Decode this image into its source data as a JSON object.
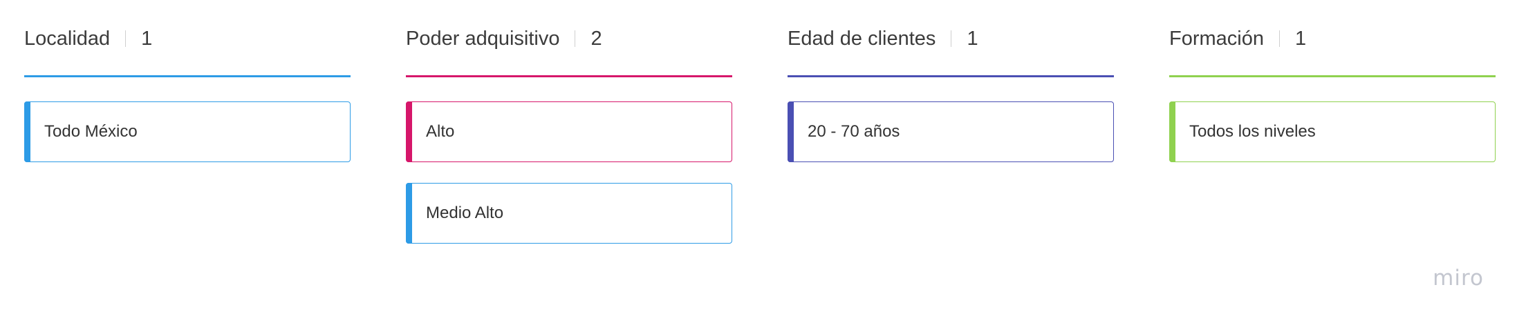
{
  "brand": {
    "logo_text": "miro"
  },
  "columns": [
    {
      "title": "Localidad",
      "count": "1",
      "color": "#2d9be6",
      "cards": [
        {
          "label": "Todo México",
          "color": "#2d9be6"
        }
      ]
    },
    {
      "title": "Poder adquisitivo",
      "count": "2",
      "color": "#d6166a",
      "cards": [
        {
          "label": "Alto",
          "color": "#d6166a"
        },
        {
          "label": "Medio Alto",
          "color": "#2d9be6"
        }
      ]
    },
    {
      "title": "Edad de clientes",
      "count": "1",
      "color": "#4a4fb3",
      "cards": [
        {
          "label": "20 - 70 años",
          "color": "#4a4fb3"
        }
      ]
    },
    {
      "title": "Formación",
      "count": "1",
      "color": "#8fd14f",
      "cards": [
        {
          "label": "Todos los niveles",
          "color": "#8fd14f"
        }
      ]
    }
  ]
}
